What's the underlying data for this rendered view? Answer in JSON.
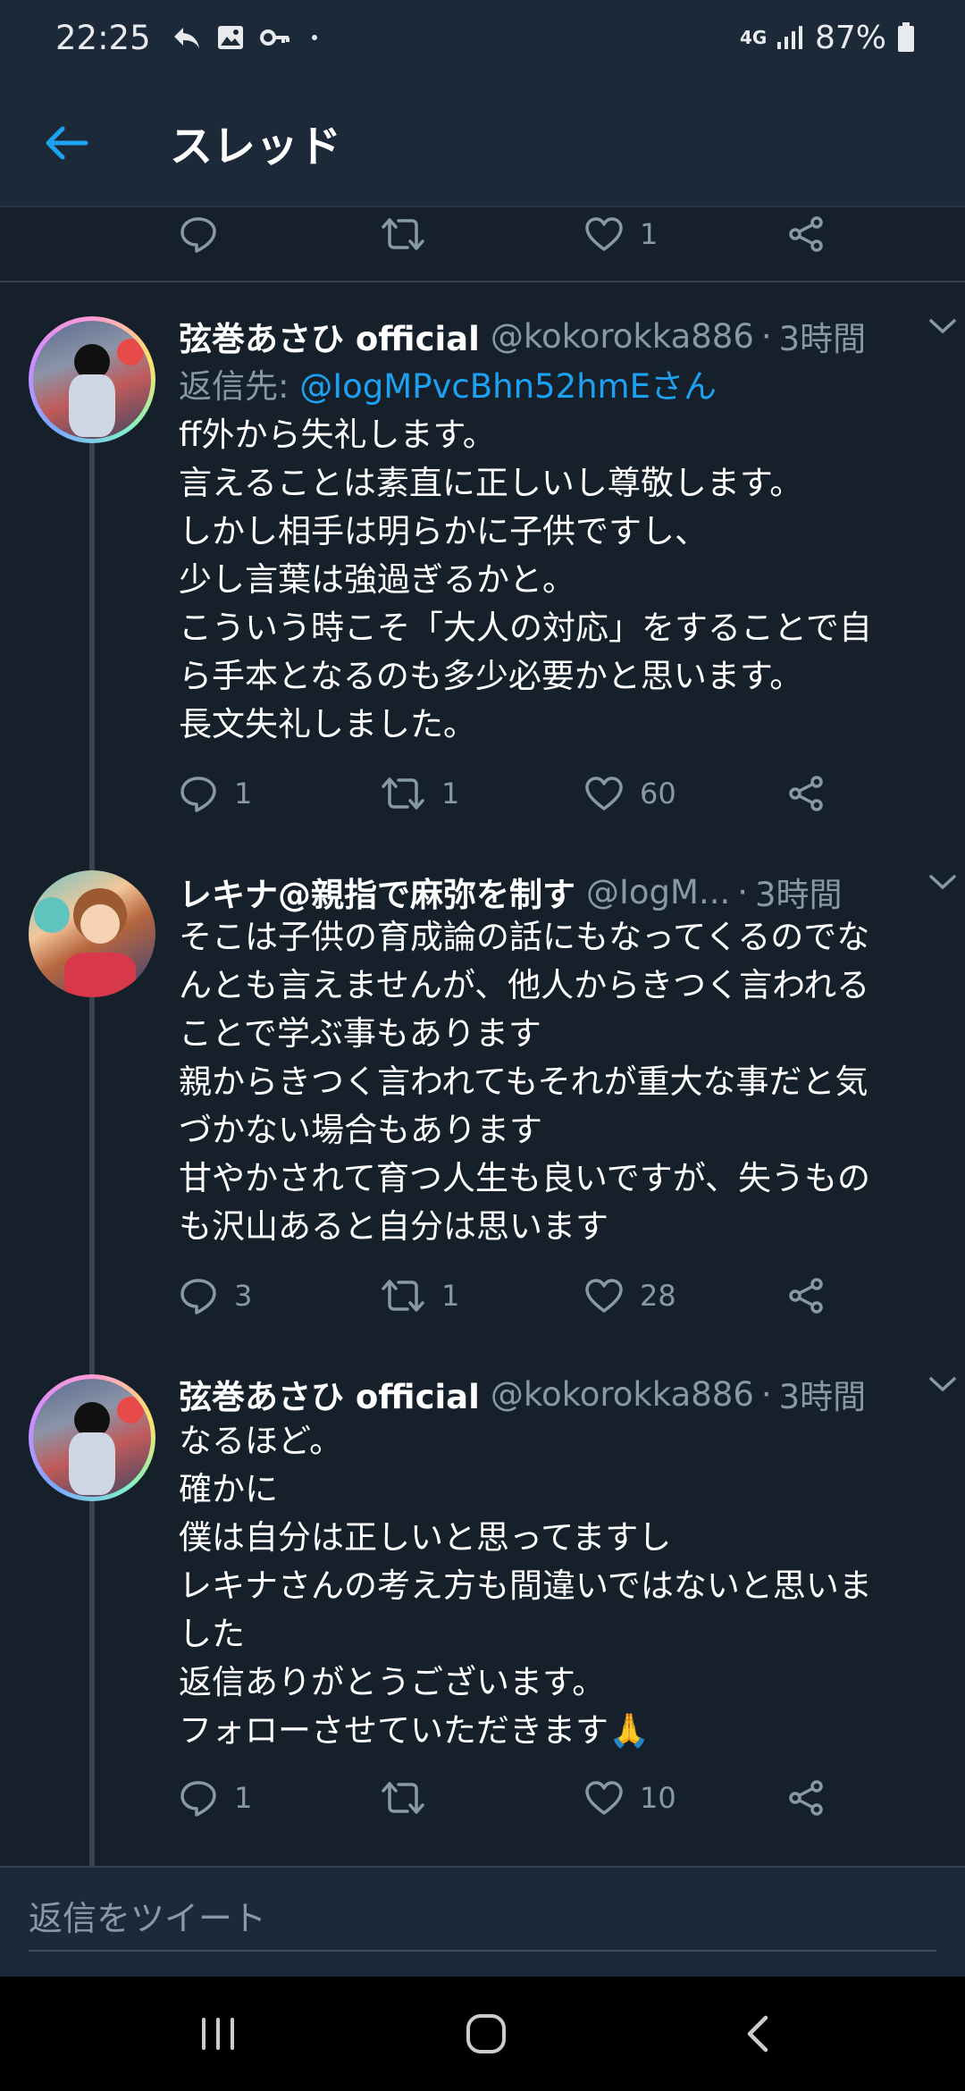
{
  "status_bar": {
    "time": "22:25",
    "network": "4G",
    "battery": "87%"
  },
  "header": {
    "title": "スレッド",
    "accent_color": "#1da1f2"
  },
  "top_actions": {
    "reply_count": "",
    "retweet_count": "",
    "like_count": "1"
  },
  "tweets": [
    {
      "name": "弦巻あさひ official",
      "handle": "@kokorokka886",
      "time": "3時間",
      "reply_to_label": "返信先:",
      "reply_to_handle": "@IogMPvcBhn52hmEさん",
      "lines": [
        "ff外から失礼します。",
        "言えることは素直に正しいし尊敬します。",
        "しかし相手は明らかに子供ですし、",
        "少し言葉は強過ぎるかと。",
        "こういう時こそ「大人の対応」をすることで自",
        "ら手本となるのも多少必要かと思います。",
        "長文失礼しました。"
      ],
      "reply_count": "1",
      "retweet_count": "1",
      "like_count": "60"
    },
    {
      "name": "レキナ@親指で麻弥を制す",
      "handle": "@IogM...",
      "time": "3時間",
      "lines": [
        "そこは子供の育成論の話にもなってくるのでな",
        "んとも言えませんが、他人からきつく言われる",
        "ことで学ぶ事もあります",
        "親からきつく言われてもそれが重大な事だと気",
        "づかない場合もあります",
        "甘やかされて育つ人生も良いですが、失うもの",
        "も沢山あると自分は思います"
      ],
      "reply_count": "3",
      "retweet_count": "1",
      "like_count": "28"
    },
    {
      "name": "弦巻あさひ official",
      "handle": "@kokorokka886",
      "time": "3時間",
      "lines": [
        "なるほど。",
        "確かに",
        "僕は自分は正しいと思ってますし",
        "レキナさんの考え方も間違いではないと思いま",
        "した",
        "返信ありがとうございます。",
        "フォローさせていただきます🙏"
      ],
      "reply_count": "1",
      "retweet_count": "",
      "like_count": "10"
    }
  ],
  "reply_box": {
    "placeholder": "返信をツイート"
  }
}
